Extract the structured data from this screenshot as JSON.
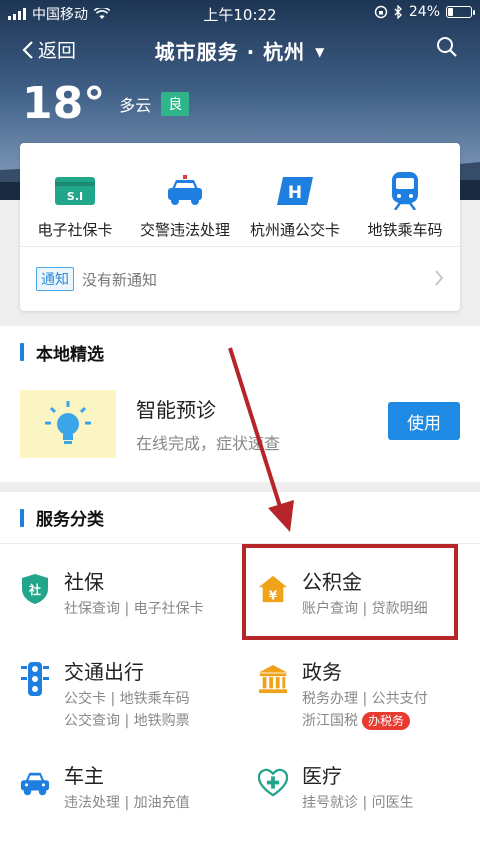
{
  "status_bar": {
    "carrier": "中国移动",
    "time": "上午10:22",
    "battery": "24%"
  },
  "nav": {
    "back_label": "返回",
    "title": "城市服务 · 杭州",
    "dropdown_glyph": "▼"
  },
  "weather": {
    "temperature": "18°",
    "condition": "多云",
    "air_quality": "良"
  },
  "quick_services": [
    {
      "label": "电子社保卡",
      "icon_text": "S.I"
    },
    {
      "label": "交警违法处理"
    },
    {
      "label": "杭州通公交卡",
      "icon_text": "H"
    },
    {
      "label": "地铁乘车码"
    }
  ],
  "notice": {
    "tag": "通知",
    "text": "没有新通知"
  },
  "local": {
    "title": "本地精选",
    "feature": {
      "title": "智能预诊",
      "subtitle": "在线完成，症状速查",
      "button": "使用"
    }
  },
  "services": {
    "title": "服务分类",
    "items": [
      {
        "title": "社保",
        "desc1": "社保查询 | 电子社保卡",
        "icon_text": "社"
      },
      {
        "title": "公积金",
        "desc1": "账户查询 | 贷款明细",
        "icon_text": "¥"
      },
      {
        "title": "交通出行",
        "desc1": "公交卡 | 地铁乘车码",
        "desc2": "公交查询 | 地铁购票"
      },
      {
        "title": "政务",
        "desc1": "税务办理 | 公共支付",
        "desc2": "浙江国税",
        "badge": "办税务"
      },
      {
        "title": "车主",
        "desc1": "违法处理 | 加油充值"
      },
      {
        "title": "医疗",
        "desc1": "挂号就诊 | 问医生"
      }
    ]
  },
  "colors": {
    "accent": "#1f8ae3",
    "highlight": "#b5252a",
    "badge": "#e83a30",
    "aqi": "#2fb58a"
  }
}
